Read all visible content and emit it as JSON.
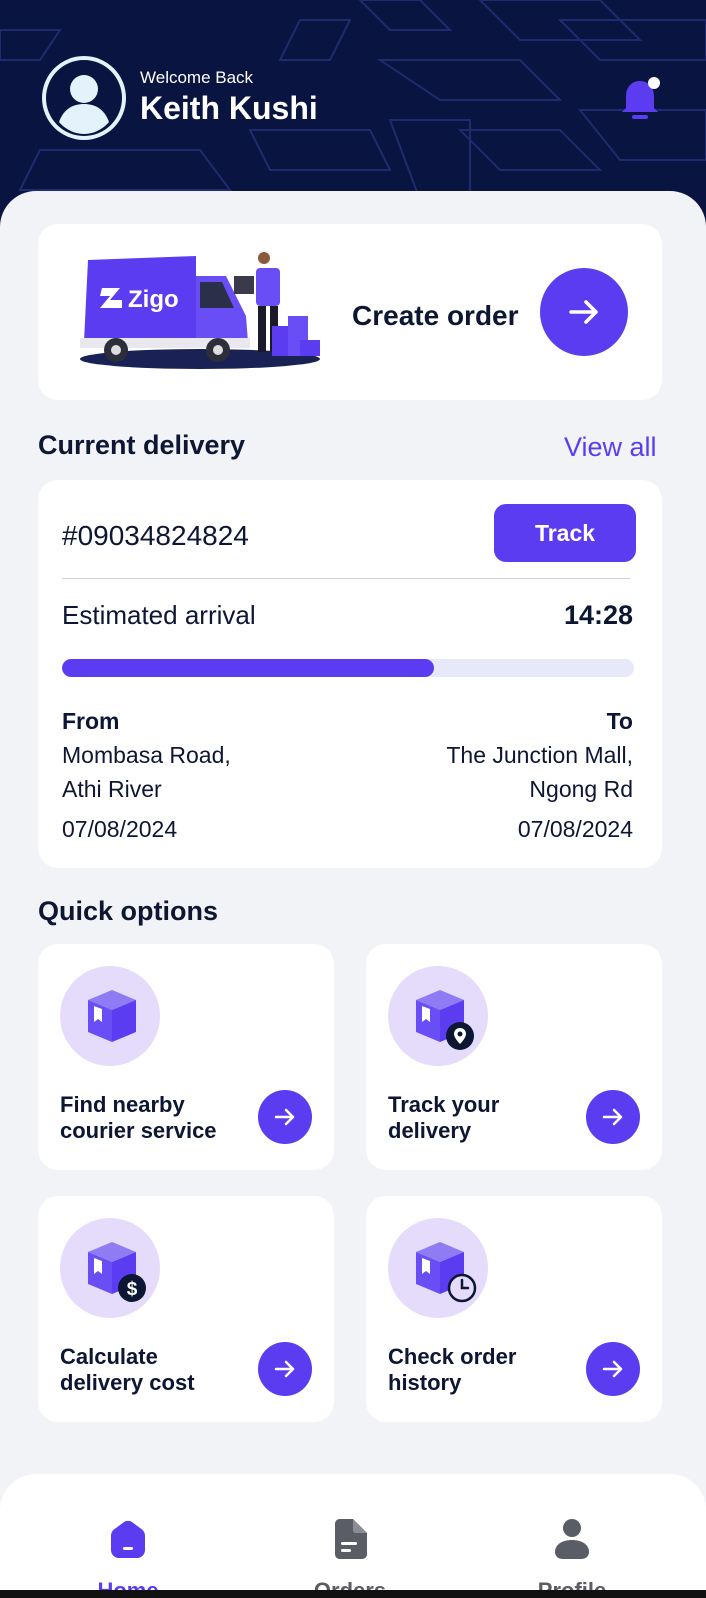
{
  "header": {
    "welcome": "Welcome Back",
    "user_name": "Keith Kushi"
  },
  "hero": {
    "brand": "Zigo",
    "title": "Create order"
  },
  "current_delivery": {
    "section_title": "Current delivery",
    "view_all": "View all",
    "order_id": "#09034824824",
    "track_label": "Track",
    "estimated_label": "Estimated arrival",
    "estimated_time": "14:28",
    "progress_fraction": 0.65,
    "from_label": "From",
    "from_line1": "Mombasa Road,",
    "from_line2": "Athi River",
    "from_date": "07/08/2024",
    "to_label": "To",
    "to_line1": "The Junction Mall,",
    "to_line2": "Ngong Rd",
    "to_date": "07/08/2024"
  },
  "quick_options": {
    "title": "Quick options",
    "items": [
      {
        "line1": "Find nearby",
        "line2": "courier service",
        "icon": "package-icon"
      },
      {
        "line1": "Track your",
        "line2": "delivery",
        "icon": "package-location-icon"
      },
      {
        "line1": "Calculate",
        "line2": "delivery cost",
        "icon": "package-cost-icon"
      },
      {
        "line1": "Check order",
        "line2": "history",
        "icon": "package-history-icon"
      }
    ]
  },
  "tabbar": {
    "items": [
      {
        "label": "Home",
        "icon": "home-icon",
        "active": true
      },
      {
        "label": "Orders",
        "icon": "orders-icon",
        "active": false
      },
      {
        "label": "Profile",
        "icon": "profile-icon",
        "active": false
      }
    ]
  },
  "colors": {
    "accent": "#5b3cf0",
    "header_bg": "#0a1440",
    "text_dark": "#0d1633",
    "inactive": "#5a5d66"
  }
}
